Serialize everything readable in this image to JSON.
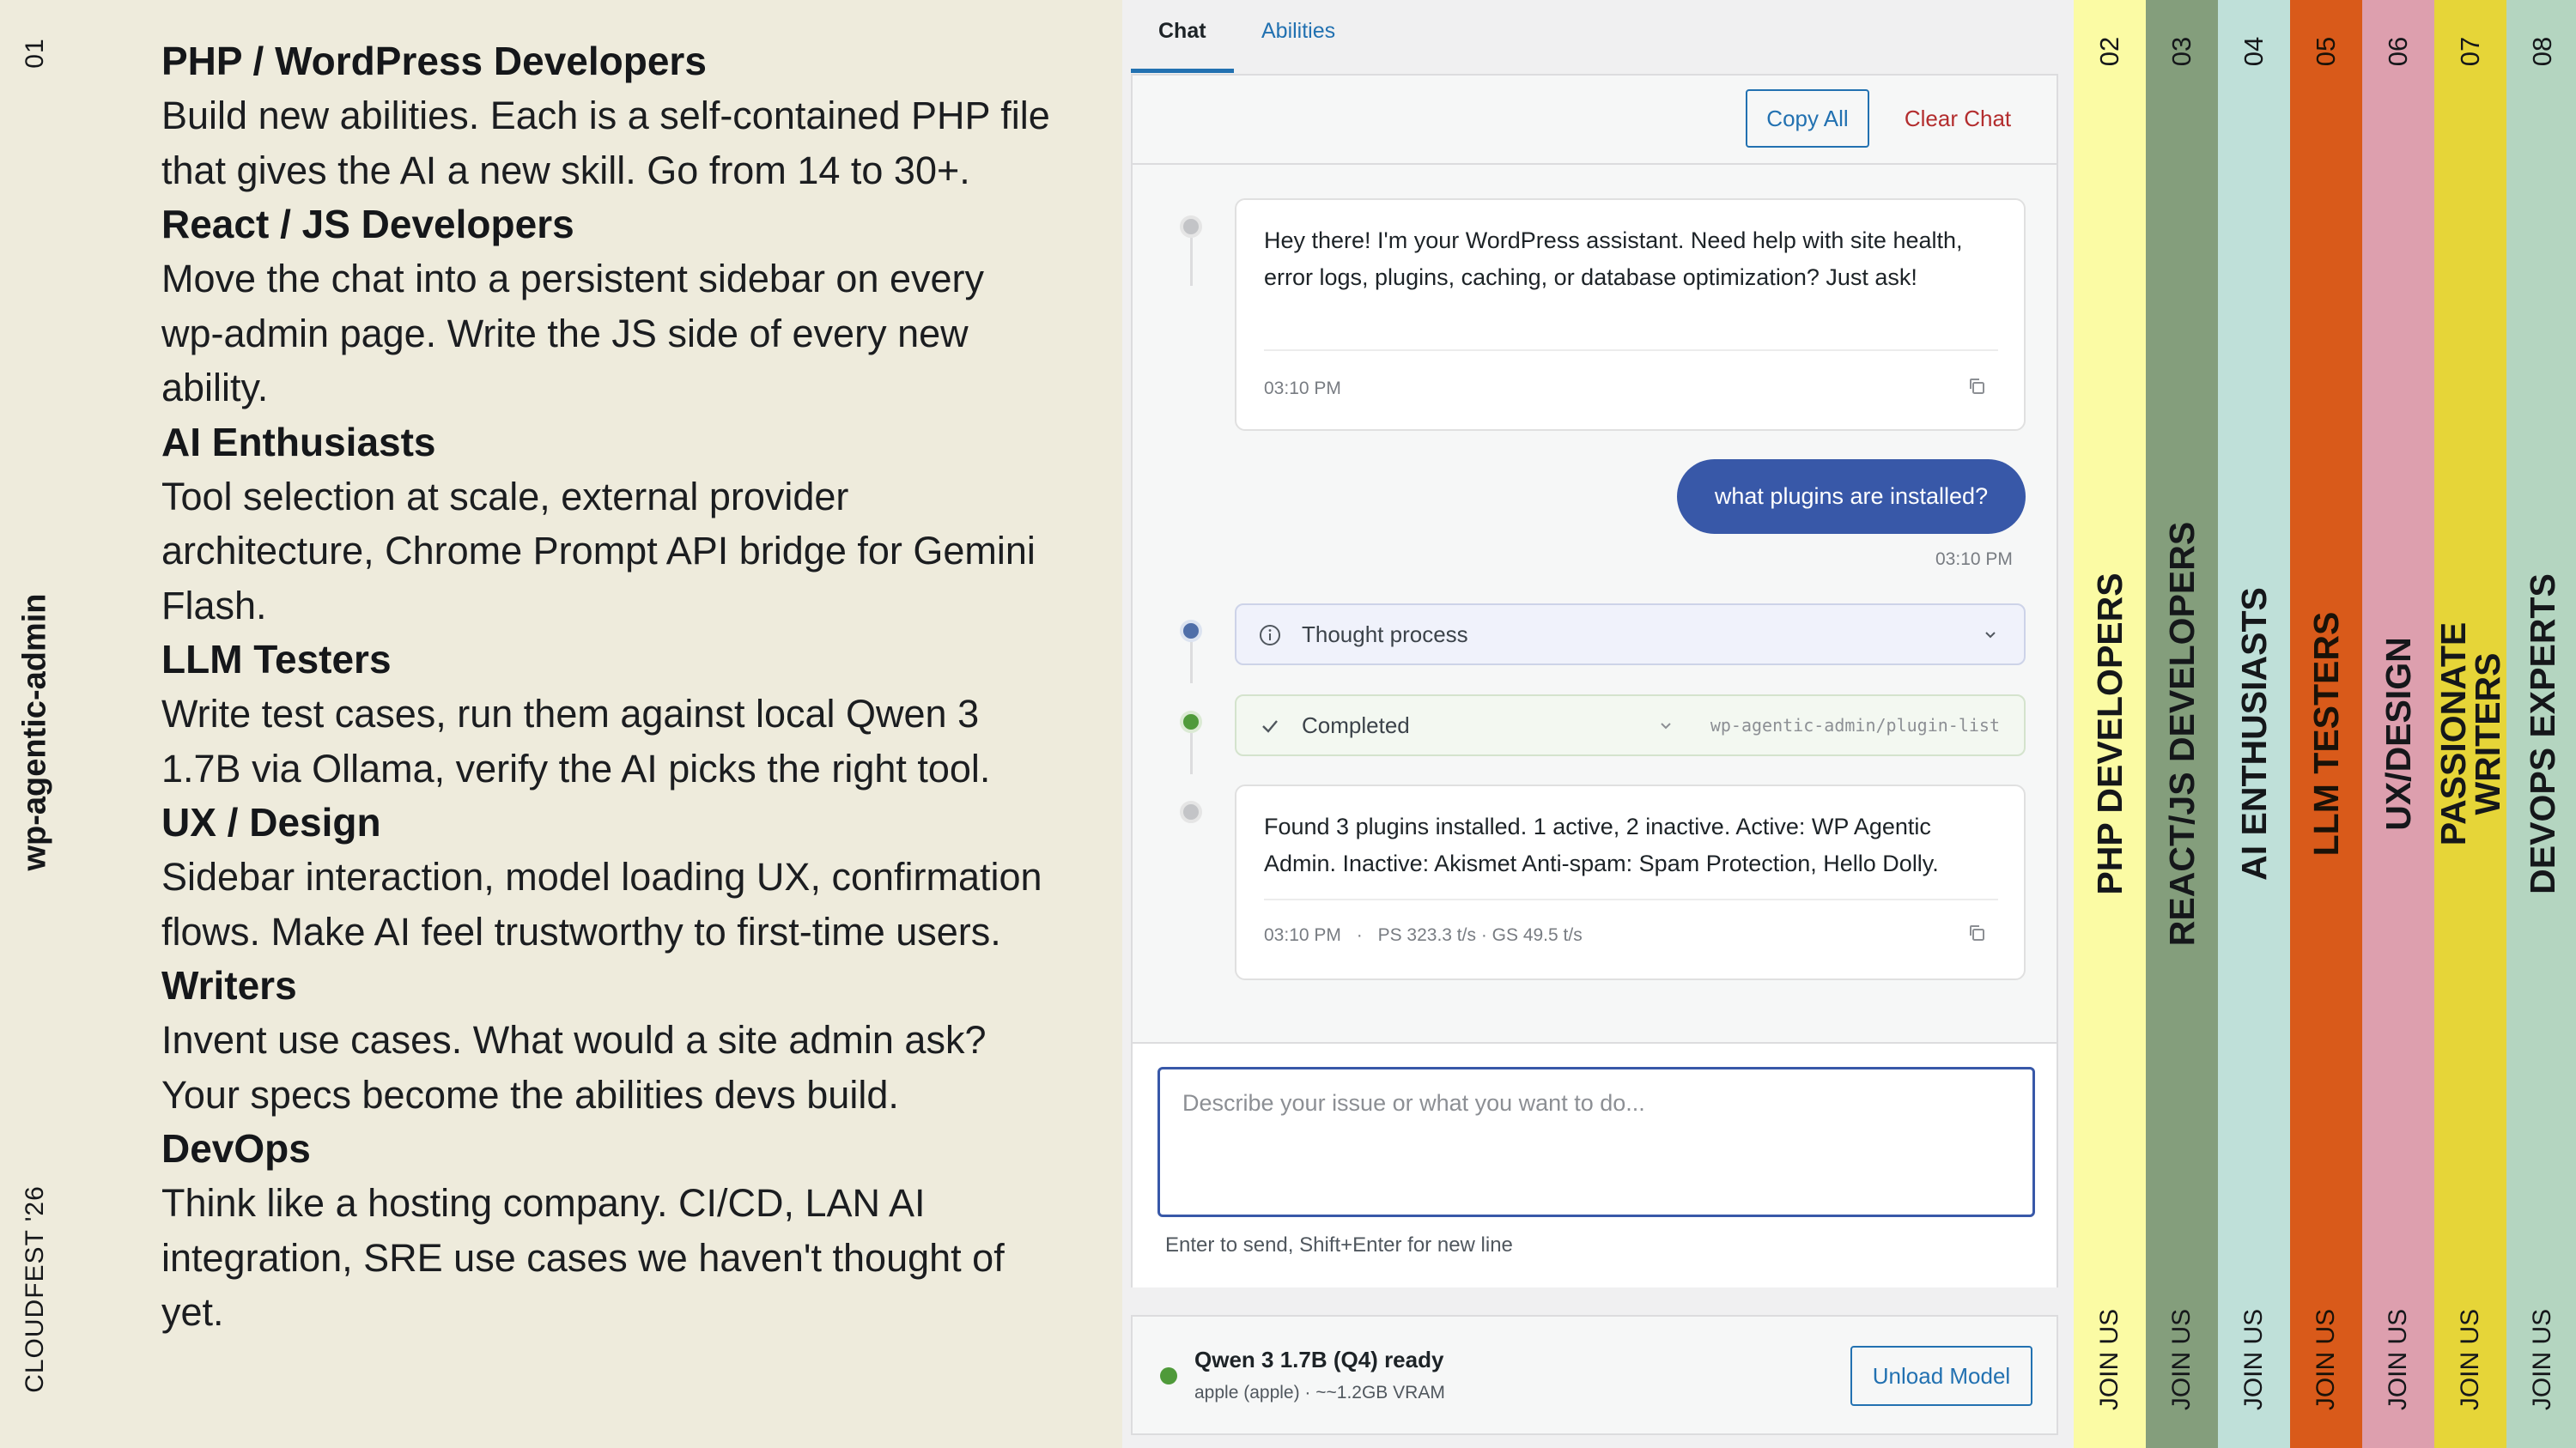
{
  "rail": {
    "number": "01",
    "title": "wp-agentic-admin",
    "event": "CLOUDFEST '26"
  },
  "roles": [
    {
      "heading": "PHP / WordPress Developers",
      "description": "Build new abilities. Each is a self-contained PHP file that gives the AI a new skill. Go from 14 to 30+."
    },
    {
      "heading": "React / JS Developers",
      "description": "Move the chat into a persistent sidebar on every wp-admin page. Write the JS side of every new ability."
    },
    {
      "heading": "AI Enthusiasts",
      "description": "Tool selection at scale, external provider architecture, Chrome Prompt API bridge for Gemini Flash."
    },
    {
      "heading": "LLM Testers",
      "description": "Write test cases, run them against local Qwen 3 1.7B via Ollama, verify the AI picks the right tool."
    },
    {
      "heading": "UX / Design",
      "description": "Sidebar interaction, model loading UX, confirmation flows. Make AI feel trustworthy to first-time users."
    },
    {
      "heading": "Writers",
      "description": "Invent use cases. What would a site admin ask? Your specs become the abilities devs build."
    },
    {
      "heading": "DevOps",
      "description": "Think like a hosting company. CI/CD, LAN AI integration, SRE use cases we haven't thought of yet."
    }
  ],
  "app": {
    "tabs": [
      {
        "label": "Chat",
        "active": true
      },
      {
        "label": "Abilities",
        "active": false
      }
    ],
    "header": {
      "copy_all": "Copy All",
      "clear_chat": "Clear Chat"
    },
    "messages": {
      "assistant_greeting": {
        "text": "Hey there! I'm your WordPress assistant. Need help with site health, error logs, plugins, caching, or database optimization? Just ask!",
        "time": "03:10 PM"
      },
      "user_message": {
        "text": "what plugins are installed?",
        "time": "03:10 PM"
      },
      "thought": {
        "label": "Thought process"
      },
      "tool_call": {
        "status": "Completed",
        "tool": "wp-agentic-admin/plugin-list"
      },
      "assistant_answer": {
        "text": "Found 3 plugins installed. 1 active, 2 inactive. Active: WP Agentic Admin. Inactive: Akismet Anti-spam: Spam Protection, Hello Dolly.",
        "time": "03:10 PM",
        "separator": "·",
        "stats": "PS 323.3 t/s · GS 49.5 t/s"
      }
    },
    "input": {
      "placeholder": "Describe your issue or what you want to do...",
      "value": "",
      "hint": "Enter to send, Shift+Enter for new line"
    },
    "model": {
      "name": "Qwen 3 1.7B (Q4) ready",
      "details": "apple (apple) · ~~1.2GB VRAM",
      "status_color": "#4f9a3a",
      "unload_label": "Unload Model"
    },
    "colors": {
      "accent": "#2271b1",
      "user_bubble": "#3858a8",
      "danger": "#b32d2e"
    }
  },
  "strips": [
    {
      "number": "02",
      "label_lines": [
        "PHP DEVELOPERS"
      ],
      "join": "JOIN US",
      "color": "#fbfba4"
    },
    {
      "number": "03",
      "label_lines": [
        "REACT/JS DEVELOPERS"
      ],
      "join": "JOIN US",
      "color": "#849e7c"
    },
    {
      "number": "04",
      "label_lines": [
        "AI ENTHUSIASTS"
      ],
      "join": "JOIN US",
      "color": "#bfe0d9"
    },
    {
      "number": "05",
      "label_lines": [
        "LLM TESTERS"
      ],
      "join": "JOIN US",
      "color": "#d95a1a"
    },
    {
      "number": "06",
      "label_lines": [
        "UX/DESIGN"
      ],
      "join": "JOIN US",
      "color": "#dd9fae"
    },
    {
      "number": "07",
      "label_lines": [
        "PASSIONATE",
        "WRITERS"
      ],
      "join": "JOIN US",
      "color": "#e6d538"
    },
    {
      "number": "08",
      "label_lines": [
        "DEVOPS EXPERTS"
      ],
      "join": "JOIN US",
      "color": "#b4d5c0"
    }
  ]
}
